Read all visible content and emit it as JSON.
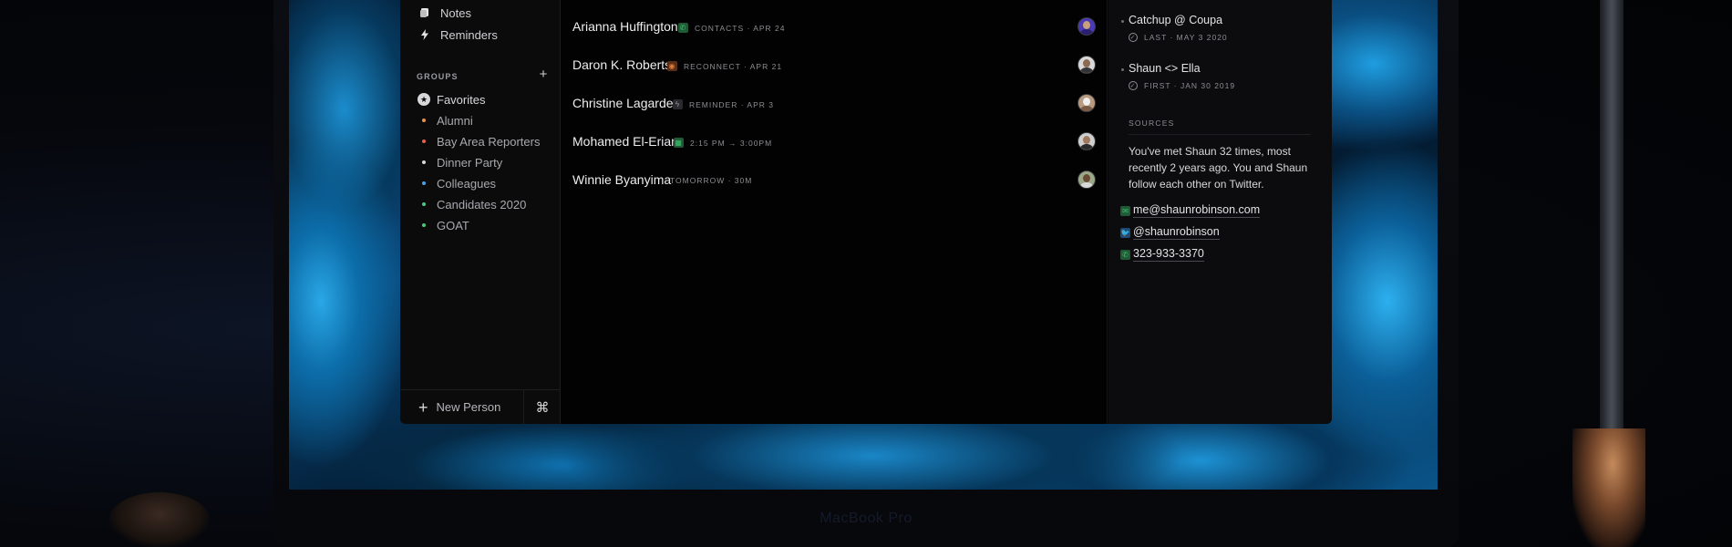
{
  "device": {
    "label": "MacBook Pro"
  },
  "sidebar": {
    "nav": [
      {
        "label": "Notes",
        "icon": "notes-icon"
      },
      {
        "label": "Reminders",
        "icon": "bolt-icon"
      }
    ],
    "groups_heading": "GROUPS",
    "groups_add_icon": "plus-icon",
    "groups": [
      {
        "label": "Favorites",
        "icon": "star-icon"
      },
      {
        "label": "Alumni",
        "color": "#e8944a"
      },
      {
        "label": "Bay Area Reporters",
        "color": "#e8604a"
      },
      {
        "label": "Dinner Party",
        "color": "#d8d8da"
      },
      {
        "label": "Colleagues",
        "color": "#4aa3e8"
      },
      {
        "label": "Candidates 2020",
        "color": "#4ac98a"
      },
      {
        "label": "GOAT",
        "color": "#4ac97a"
      }
    ],
    "footer": {
      "new_person": "New Person",
      "command_icon": "command-icon"
    }
  },
  "people": [
    {
      "name": "Arianna Huffington",
      "meta": "CONTACTS · APR 24",
      "icon": "phone-icon",
      "icon_color": "#3ec06e"
    },
    {
      "name": "Daron K. Roberts",
      "meta": "RECONNECT · APR 21",
      "icon": "reconnect-icon",
      "icon_color": "#e07b3c"
    },
    {
      "name": "Christine Lagarde",
      "meta": "REMINDER · APR 3",
      "icon": "bolt-icon",
      "icon_color": "#8d8e93"
    },
    {
      "name": "Mohamed El-Erian",
      "meta": "2:15 PM → 3:00PM",
      "icon": "calendar-icon",
      "icon_color": "#3ec06e"
    },
    {
      "name": "Winnie Byanyima",
      "meta": "TOMORROW · 30M",
      "icon": "",
      "icon_color": ""
    }
  ],
  "detail": {
    "timeline": [
      {
        "title": "Catchup @ Coupa",
        "sub": "LAST · MAY 3 2020"
      },
      {
        "title": "Shaun <> Ella",
        "sub": "FIRST · JAN 30 2019"
      }
    ],
    "sources_heading": "SOURCES",
    "sources_text": "You've met Shaun 32 times, most recently 2 years ago. You and Shaun follow each other on Twitter.",
    "links": [
      {
        "label": "me@shaunrobinson.com",
        "icon": "email-icon",
        "color": "#3ec06e"
      },
      {
        "label": "@shaunrobinson",
        "icon": "twitter-icon",
        "color": "#3b8fe0"
      },
      {
        "label": "323-933-3370",
        "icon": "phone-icon",
        "color": "#3ec06e"
      }
    ]
  }
}
